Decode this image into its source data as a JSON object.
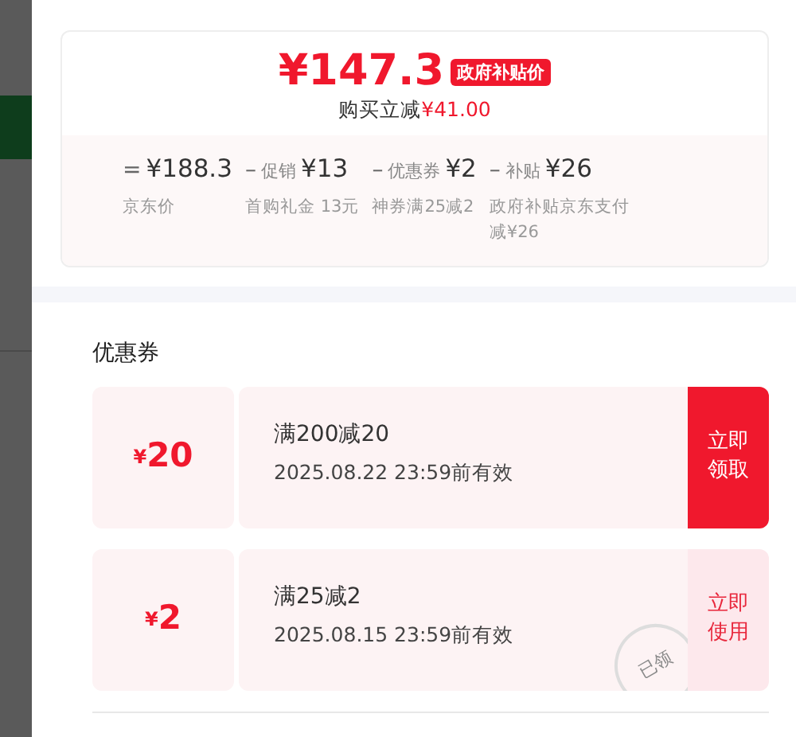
{
  "price": {
    "amount": "¥147.3",
    "badge": "政府补贴价",
    "saving_label": "购买立减",
    "saving_amount": "¥41.00"
  },
  "breakdown": [
    {
      "op": "=",
      "amount": "¥188.3",
      "note": "京东价"
    },
    {
      "op": "–",
      "label": "促销",
      "amount": "¥13",
      "note": "首购礼金 13元"
    },
    {
      "op": "–",
      "label": "优惠券",
      "amount": "¥2",
      "note": "神券满25减2"
    },
    {
      "op": "–",
      "label": "补贴",
      "amount": "¥26",
      "note": "政府补贴京东支付减¥26"
    }
  ],
  "coupons_title": "优惠券",
  "coupons": [
    {
      "currency": "¥",
      "value": "20",
      "condition": "满200减20",
      "expiry": "2025.08.22 23:59前有效",
      "button": "立即领取",
      "claimed": false
    },
    {
      "currency": "¥",
      "value": "2",
      "condition": "满25减2",
      "expiry": "2025.08.15 23:59前有效",
      "button": "立即使用",
      "claimed": true,
      "stamp": "已领"
    }
  ]
}
